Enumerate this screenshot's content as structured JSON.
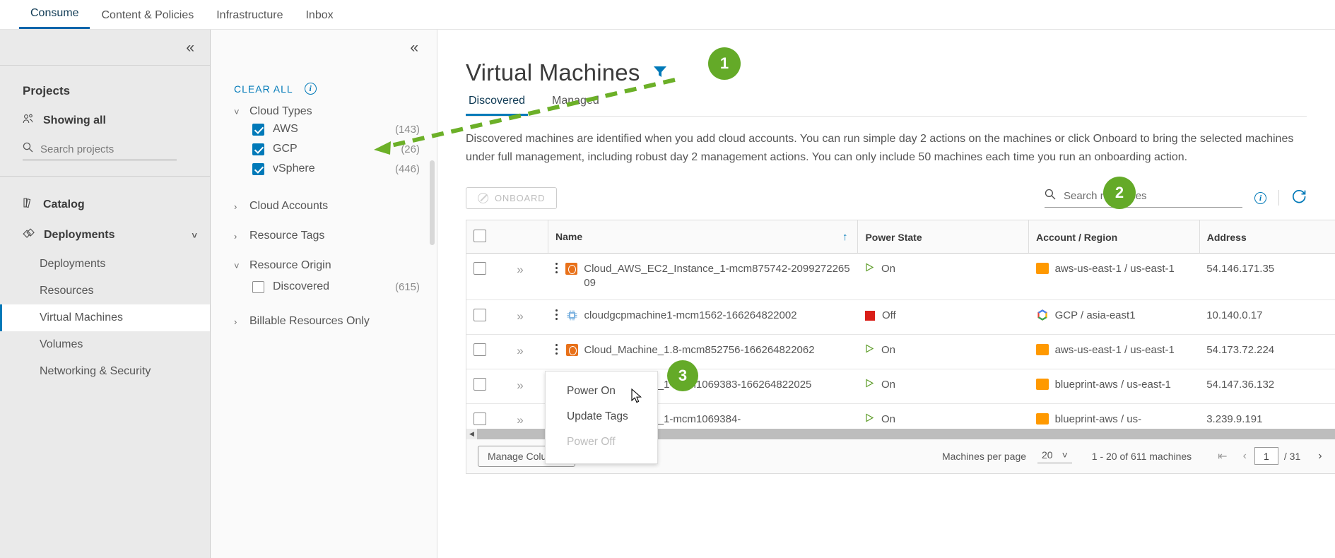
{
  "topnav": {
    "items": [
      {
        "label": "Consume",
        "active": true
      },
      {
        "label": "Content & Policies",
        "active": false
      },
      {
        "label": "Infrastructure",
        "active": false
      },
      {
        "label": "Inbox",
        "active": false
      }
    ]
  },
  "leftnav": {
    "collapse_icon": "double-chevron-left",
    "title": "Projects",
    "showing_all": "Showing all",
    "search_placeholder": "Search projects",
    "items": [
      {
        "label": "Catalog",
        "icon": "catalog-icon",
        "type": "top"
      },
      {
        "label": "Deployments",
        "icon": "deployments-icon",
        "type": "top-expanded",
        "chevron": "chevron-down"
      },
      {
        "label": "Deployments",
        "type": "sub"
      },
      {
        "label": "Resources",
        "type": "sub"
      },
      {
        "label": "Virtual Machines",
        "type": "sub",
        "selected": true
      },
      {
        "label": "Volumes",
        "type": "sub"
      },
      {
        "label": "Networking & Security",
        "type": "sub"
      }
    ]
  },
  "filters": {
    "collapse_icon": "double-chevron-left",
    "clear_all": "CLEAR ALL",
    "info_icon": "info-icon",
    "groups": [
      {
        "name": "Cloud Types",
        "expanded": true,
        "options": [
          {
            "label": "AWS",
            "count": "(143)",
            "checked": true
          },
          {
            "label": "GCP",
            "count": "(26)",
            "checked": true
          },
          {
            "label": "vSphere",
            "count": "(446)",
            "checked": true
          }
        ]
      },
      {
        "name": "Cloud Accounts",
        "expanded": false,
        "options": []
      },
      {
        "name": "Resource Tags",
        "expanded": false,
        "options": []
      },
      {
        "name": "Resource Origin",
        "expanded": true,
        "options": [
          {
            "label": "Discovered",
            "count": "(615)",
            "checked": false
          }
        ]
      },
      {
        "name": "Billable Resources Only",
        "expanded": false,
        "options": []
      }
    ]
  },
  "main": {
    "title": "Virtual Machines",
    "filter_icon": "funnel-icon",
    "tabs": [
      {
        "label": "Discovered",
        "active": true
      },
      {
        "label": "Managed",
        "active": false
      }
    ],
    "description": "Discovered machines are identified when you add cloud accounts. You can run simple day 2 actions on the machines or click Onboard to bring the selected machines under full management, including robust day 2 management actions. You can only include 50 machines each time you run an onboarding action.",
    "onboard_label": "ONBOARD",
    "onboard_icon": "no-entry-icon",
    "search_placeholder": "Search resources",
    "search_value": "",
    "search_icon": "search-icon",
    "info_icon": "info-icon",
    "refresh_icon": "refresh-icon"
  },
  "table": {
    "columns": [
      "Name",
      "Power State",
      "Account / Region",
      "Address"
    ],
    "sort_column": "Name",
    "sort_direction": "asc",
    "sort_icon": "arrow-up-icon",
    "rows": [
      {
        "name": "Cloud_AWS_EC2_Instance_1-mcm875742-209927226509",
        "icon": "aws-ec2-icon",
        "power_state": "On",
        "power_icon": "play-triangle-icon",
        "account_region": "aws-us-east-1 / us-east-1",
        "account_icon": "aws-icon",
        "address": "54.146.171.35"
      },
      {
        "name": "cloudgcpmachine1-mcm1562-166264822002",
        "icon": "gcp-vm-icon",
        "power_state": "Off",
        "power_icon": "stop-square-icon",
        "account_region": "GCP / asia-east1",
        "account_icon": "gcp-icon",
        "address": "10.140.0.17"
      },
      {
        "name": "Cloud_Machine_1.8-mcm852756-166264822062",
        "icon": "aws-ec2-icon",
        "power_state": "On",
        "power_icon": "play-triangle-icon",
        "account_region": "aws-us-east-1 / us-east-1",
        "account_icon": "aws-icon",
        "address": "54.173.72.224"
      },
      {
        "name": "Cloud_Machine_1-mcm1069383-166264822025",
        "icon": "aws-ec2-icon",
        "power_state": "On",
        "power_icon": "play-triangle-icon",
        "account_region": "blueprint-aws / us-east-1",
        "account_icon": "aws-icon",
        "address": "54.147.36.132"
      },
      {
        "name": "Cloud_Machine_1-mcm1069384-",
        "icon": "aws-ec2-icon",
        "power_state": "On",
        "power_icon": "play-triangle-icon",
        "account_region": "blueprint-aws / us-",
        "account_icon": "aws-icon",
        "address": "3.239.9.191"
      }
    ]
  },
  "context_menu": {
    "items": [
      {
        "label": "Power On",
        "disabled": false
      },
      {
        "label": "Update Tags",
        "disabled": false
      },
      {
        "label": "Power Off",
        "disabled": true
      }
    ]
  },
  "footer": {
    "manage_columns": "Manage Columns",
    "per_page_label": "Machines per page",
    "per_page_value": "20",
    "range_text": "1 - 20 of 611 machines",
    "current_page": "1",
    "total_pages": "/ 31",
    "first_icon": "first-page-icon",
    "prev_icon": "prev-page-icon",
    "next_icon": "next-page-icon",
    "last_icon": "last-page-icon"
  },
  "annotations": {
    "badges": [
      {
        "number": "1",
        "color": "#64aa28"
      },
      {
        "number": "2",
        "color": "#64aa28"
      },
      {
        "number": "3",
        "color": "#64aa28"
      }
    ],
    "arrow_color": "#6cb028"
  }
}
